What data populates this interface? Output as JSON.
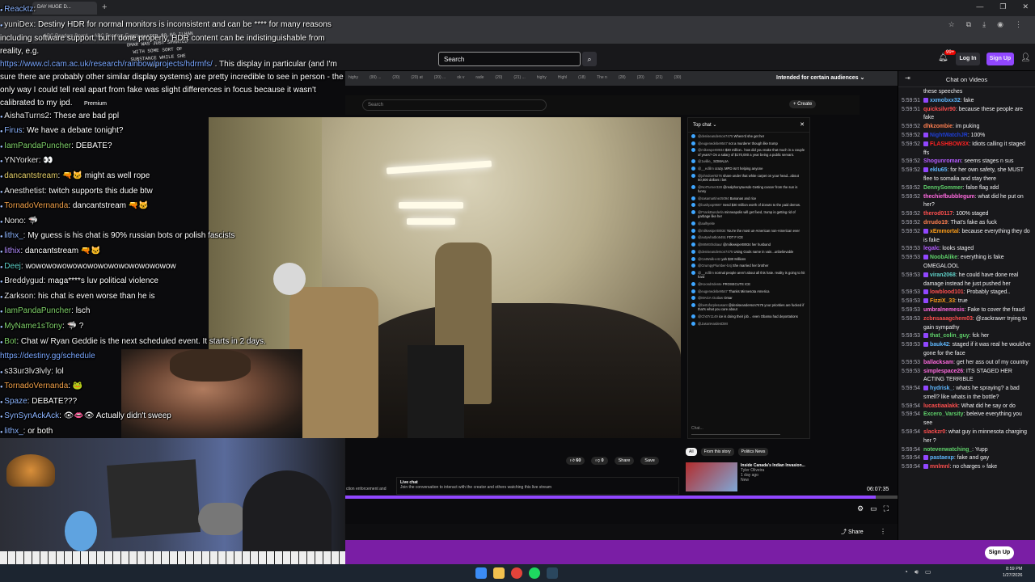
{
  "browser": {
    "tab_title": "DAY HUGE D...",
    "bookmarks": "ABC Readers Board ... ABC Readers Event",
    "window_controls": [
      "—",
      "❐",
      "✕"
    ]
  },
  "twitch_nav": {
    "search_placeholder": "Search",
    "notification_count": "99+",
    "login_label": "Log In",
    "signup_label": "Sign Up"
  },
  "inner_browser": {
    "tabs": [
      "highy",
      "(99) ...",
      "(20)",
      "(20) at",
      "(20) ...",
      "ok v",
      "rade",
      "(20)",
      "(21) ...",
      "highy",
      "Highl",
      "(18)",
      "The n",
      "(28)",
      "(20)",
      "(21)",
      "(30)"
    ],
    "audience_label": "Intended for certain audiences"
  },
  "youtube": {
    "premium_label": "Premium",
    "search_placeholder": "Search",
    "create_label": "+ Create",
    "top_chat_label": "Top chat",
    "chat_input_placeholder": "Chat...",
    "chat_messages": [
      {
        "user": "@deniseanderson7475",
        "text": "Where'd she get her"
      },
      {
        "user": "@eugenedebe9547",
        "text": "not a murderer though like trump"
      },
      {
        "user": "@mikewpert8934",
        "text": "$30 million.. how did you make that much in a couple of years? On a salary of $170,000 a year being a public servant."
      },
      {
        "user": "@1willie_",
        "text": "SOMALIA"
      },
      {
        "user": "@__edlilm",
        "text": "crazy. MPD isn't helping anyone"
      },
      {
        "user": "@johndoer9276",
        "text": "share under that white carpet on your head...about 50,000 dollars i bet"
      },
      {
        "user": "@NotTurner328",
        "text": "@realphonytuesdo Getting cancer from the sun is funny"
      },
      {
        "user": "@sasamartinez5094",
        "text": "Bananas and rice"
      },
      {
        "user": "@bushpop9667",
        "text": "Send $30 million worth of donuts to the paid demos."
      },
      {
        "user": "@FrankBunderla",
        "text": "minneapolis will get fixed, trump is getting rid of garbage like her"
      },
      {
        "user": "@aalhyeite",
        "text": ""
      },
      {
        "user": "@milkewipert8934",
        "text": "You're the most un-American non-American ever"
      },
      {
        "user": "@autywhatbo5451",
        "text": "FDT F ICE"
      },
      {
        "user": "@MrMrShobaur",
        "text": "@milkewipert8934 her husband"
      },
      {
        "user": "@deniseanderson7475",
        "text": "Using Gods name in vain...unbelievable"
      },
      {
        "user": "@CatWalk-e4z",
        "text": "yah $30 Millions"
      },
      {
        "user": "@GrumpyPlumber-b4j",
        "text": "She married her brother"
      },
      {
        "user": "@__edlilm",
        "text": "normal people aren't about all this hate. reality is going to hit hard"
      },
      {
        "user": "@KoondXdente",
        "text": "PROSECUTE ICE"
      },
      {
        "user": "@eugenedebe9547",
        "text": "Thanks Minnesota America"
      },
      {
        "user": "@MAGA-Outlaw",
        "text": "Omar"
      },
      {
        "user": "@bertoforplesasant",
        "text": "@deniseanderson7475 your priorities are fucked if that's what you care about"
      },
      {
        "user": "@Ch07r1149",
        "text": "ice is doing their job .. even Obama had deportations"
      },
      {
        "user": "@JasonHardenDMI",
        "text": ""
      }
    ],
    "actions": [
      "60",
      "0",
      "Share",
      "Save"
    ],
    "chips": [
      "All",
      "From this story",
      "Politics News"
    ],
    "rec_title": "Inside Canada's Indian Invasion...",
    "rec_channel": "Tyler Oliveira",
    "rec_meta": "1 day ago",
    "rec_tag": "New",
    "live_chat_title": "Live chat",
    "live_chat_text": "Join the conversation to interact with the creator and others watching this live stream",
    "left_caption": "ction enforcement and",
    "timecode": "06:07:35",
    "progress": 0.96
  },
  "webcam": {
    "board_text": "SHAPE DONATED $0.00 ILHAN OMAR WAS JUST SPRAYED WITH SOME SORT OF SUBSTANCE WHILE SHE WAS..."
  },
  "overlay_chat": [
    {
      "user": "Reacktz",
      "text": "",
      "color": "u-blue"
    },
    {
      "user": "yuniDex",
      "text": "Destiny HDR for normal monitors is inconsistent and can be **** for many reasons including software support, but if done properly, HDR content can be indistinguishable from reality, e.g.",
      "color": "u-white",
      "wrap": true
    },
    {
      "user": "",
      "text": "",
      "link": "https://www.cl.cam.ac.uk/research/rainbow/projects/hdrmfs/",
      "after": " . This display in particular (and I'm sure there are probably other similar display systems) are pretty incredible to see in person - the only way I could tell real apart from fake was slight differences in focus because it wasn't calibrated to my ipd.",
      "wrap": true
    },
    {
      "user": "AishaTurns2",
      "text": "These are bad ppl",
      "color": "u-white"
    },
    {
      "user": "Firus",
      "text": "We have a debate tonight?",
      "color": "u-blue"
    },
    {
      "user": "IamPandaPuncher",
      "text": "DEBATE?",
      "color": "u-green"
    },
    {
      "user": "YNYorker",
      "text": "👀",
      "color": "u-white"
    },
    {
      "user": "dancantstream",
      "text": "🔫🐱 might as well rope",
      "color": "u-yellow"
    },
    {
      "user": "Anesthetist",
      "text": "twitch supports this dude btw",
      "color": "u-white"
    },
    {
      "user": "TornadoVernanda",
      "text": "dancantstream 🔫🐱",
      "color": "u-orange"
    },
    {
      "user": "Nono",
      "text": "🦈",
      "color": "u-white"
    },
    {
      "user": "lithx_",
      "text": "My guess is his chat is 90% russian bots or polish fascists",
      "color": "u-blue"
    },
    {
      "user": "lithix",
      "text": "dancantstream 🔫🐱",
      "color": "u-purple"
    },
    {
      "user": "Deej",
      "text": "wowowowowowowowowowowowowowow",
      "color": "u-teal"
    },
    {
      "user": "Breddygud",
      "text": "maga****s luv political violence",
      "color": "u-white"
    },
    {
      "user": "Zarkson",
      "text": "his chat is even worse than he is",
      "color": "u-white"
    },
    {
      "user": "IamPandaPuncher",
      "text": "lsch",
      "color": "u-green"
    },
    {
      "user": "MyName1sTony",
      "text": "🦈 ?",
      "color": "u-green"
    },
    {
      "user": "Bot",
      "text": "Chat w/ Ryan Geddie is the next scheduled event. It starts in 2 days.",
      "color": "u-green"
    },
    {
      "user": "",
      "text": "",
      "link": "https://destiny.gg/schedule",
      "after": ""
    },
    {
      "user": "s33ur3lv3lvly",
      "text": "lol",
      "color": "u-white"
    },
    {
      "user": "TornadoVernanda",
      "text": "🐸",
      "color": "u-orange"
    },
    {
      "user": "Spaze",
      "text": "DEBATE???",
      "color": "u-blue"
    },
    {
      "user": "SynSynAckAck",
      "text": "👁👄👁 Actually didn't sweep",
      "color": "u-blue"
    },
    {
      "user": "lithx_",
      "text": "or both",
      "color": "u-blue"
    }
  ],
  "twitch_chat": {
    "title": "Chat on Videos",
    "messages": [
      {
        "ts": "",
        "user": "",
        "text": "these speeches",
        "color": "#efeff1",
        "badge": ""
      },
      {
        "ts": "5:59:51",
        "user": "xxmobxx32",
        "text": "fake",
        "color": "#5fb8ff",
        "badge": "#9147ff"
      },
      {
        "ts": "5:59:51",
        "user": "quicksilvr90",
        "text": "because these people are fake",
        "color": "#ff4f4f",
        "badge": ""
      },
      {
        "ts": "5:59:52",
        "user": "dhkzombie",
        "text": "im puking",
        "color": "#ff7f50",
        "badge": ""
      },
      {
        "ts": "5:59:52",
        "user": "NightWatchJR",
        "text": "100%",
        "color": "#1e3fd8",
        "badge": "#9147ff"
      },
      {
        "ts": "5:59:52",
        "user": "FLASHBOW3X",
        "text": "Idiots calling it staged ffs",
        "color": "#ff2222",
        "badge": "#9147ff"
      },
      {
        "ts": "5:59:52",
        "user": "Shogunroman",
        "text": "seems stages n sus",
        "color": "#b45cff",
        "badge": ""
      },
      {
        "ts": "5:59:52",
        "user": "eklu65",
        "text": "for her own safety, she MUST flee to somalia and stay there",
        "color": "#5fb8ff",
        "badge": "#9147ff"
      },
      {
        "ts": "5:59:52",
        "user": "DennySommer",
        "text": "false flag xdd",
        "color": "#5fd16a",
        "badge": ""
      },
      {
        "ts": "5:59:52",
        "user": "thechiefbubblegum",
        "text": "what did he put on her?",
        "color": "#ff6adf",
        "badge": ""
      },
      {
        "ts": "5:59:52",
        "user": "therod0117",
        "text": "100% staged",
        "color": "#ff4f4f",
        "badge": ""
      },
      {
        "ts": "5:59:52",
        "user": "drrudo19",
        "text": "That's fake as fuck",
        "color": "#ff7f50",
        "badge": ""
      },
      {
        "ts": "5:59:52",
        "user": "xEmmortal",
        "text": "because everything they do is fake",
        "color": "#ff9f1a",
        "badge": "#9147ff"
      },
      {
        "ts": "5:59:53",
        "user": "legalc",
        "text": "looks staged",
        "color": "#b45cff",
        "badge": ""
      },
      {
        "ts": "5:59:53",
        "user": "NoobAlike",
        "text": "everything is fake OMEGALOOL",
        "color": "#5fd16a",
        "badge": "#9147ff"
      },
      {
        "ts": "5:59:53",
        "user": "viran2068",
        "text": "he could have done real damage instead he just pushed her",
        "color": "#5fd1c9",
        "badge": "#9147ff"
      },
      {
        "ts": "5:59:53",
        "user": "lowblood101",
        "text": "Probably staged..",
        "color": "#ff4f4f",
        "badge": "#9147ff"
      },
      {
        "ts": "5:59:53",
        "user": "FizziX_33",
        "text": "true",
        "color": "#ff9f1a",
        "badge": "#9147ff"
      },
      {
        "ts": "5:59:53",
        "user": "umbralnemesis",
        "text": "Fake to cover the fraud",
        "color": "#ff6adf",
        "badge": ""
      },
      {
        "ts": "5:59:53",
        "user": "zcbnsaaagchem03",
        "text": "@zackrawrr trying to gain sympathy",
        "color": "#ff4f4f",
        "badge": ""
      },
      {
        "ts": "5:59:53",
        "user": "that_colin_guy",
        "text": "fck her",
        "color": "#5fd16a",
        "badge": "#9147ff"
      },
      {
        "ts": "5:59:53",
        "user": "bauk42",
        "text": "staged if it was real he would've gone for the face",
        "color": "#5fb8ff",
        "badge": "#9147ff"
      },
      {
        "ts": "5:59:53",
        "user": "ballacksam",
        "text": "get her ass out of my country",
        "color": "#ff6adf",
        "badge": ""
      },
      {
        "ts": "5:59:53",
        "user": "simplespace26",
        "text": "ITS STAGED HER ACTING TERRIBLE",
        "color": "#ff6adf",
        "badge": ""
      },
      {
        "ts": "5:59:54",
        "user": "hydrisk_",
        "text": "whats he spraying? a bad smell? like whats in the bottle?",
        "color": "#5fb8ff",
        "badge": "#9147ff"
      },
      {
        "ts": "5:59:54",
        "user": "lucastiaalakk",
        "text": "What did he say or do",
        "color": "#ff4f4f",
        "badge": ""
      },
      {
        "ts": "5:59:54",
        "user": "Excero_Varsity",
        "text": "beleive everything you see",
        "color": "#5fd16a",
        "badge": ""
      },
      {
        "ts": "5:59:54",
        "user": "slackzr0",
        "text": "what guy in minnesota charging her ?",
        "color": "#ff4f4f",
        "badge": ""
      },
      {
        "ts": "5:59:54",
        "user": "notevenwatching_",
        "text": "Yupp",
        "color": "#5fd16a",
        "badge": ""
      },
      {
        "ts": "5:59:54",
        "user": "pastaexp",
        "text": "fake and gay",
        "color": "#5fb8ff",
        "badge": "#9147ff"
      },
      {
        "ts": "5:59:54",
        "user": "mnlmnl",
        "text": "no charges » fake",
        "color": "#ff4f4f",
        "badge": "#9147ff"
      }
    ]
  },
  "banner": {
    "signup_label": "Sign Up"
  },
  "taskbar": {
    "time": "8:59 PM",
    "date": "1/27/2026"
  }
}
